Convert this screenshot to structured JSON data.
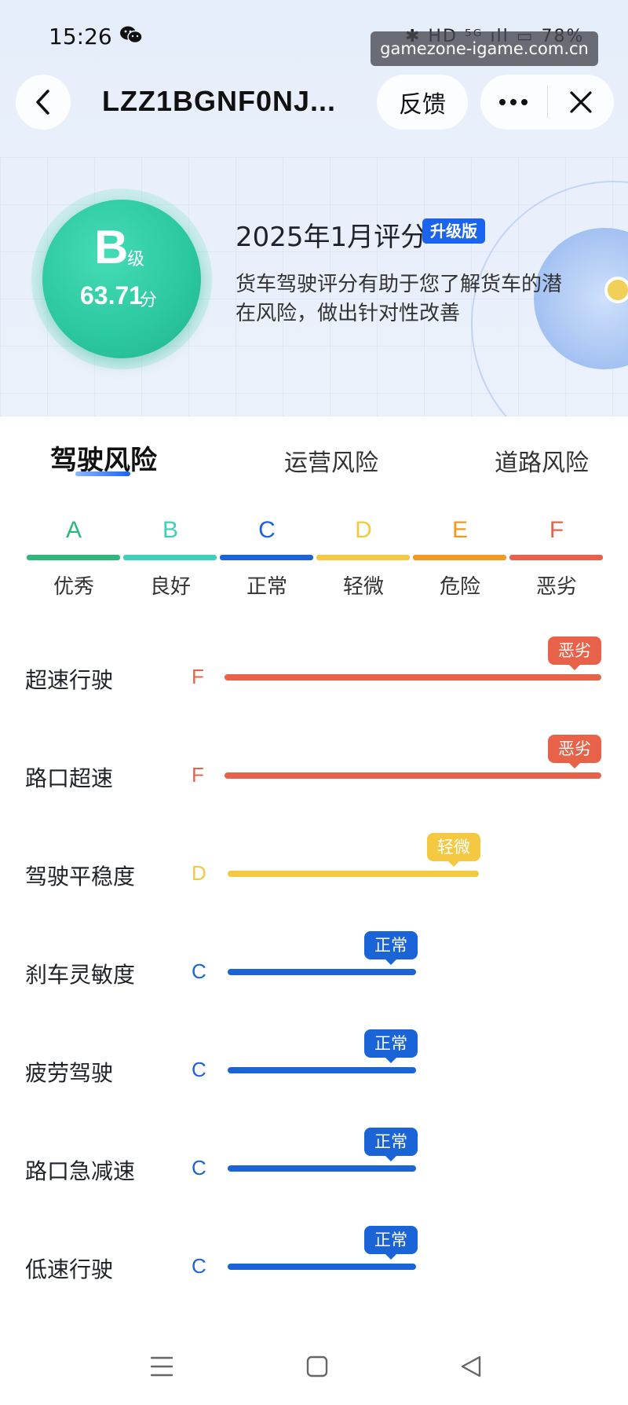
{
  "status_bar": {
    "time": "15:26",
    "right_text": "✱ HD ⁵ᴳ ıll ▭ 78%",
    "battery": "78%"
  },
  "watermark": "gamezone-igame.com.cn",
  "nav": {
    "title": "LZZ1BGNF0NJ...",
    "feedback_label": "反馈"
  },
  "hero": {
    "grade_letter": "B",
    "grade_suffix": "级",
    "score": "63.71",
    "score_unit": "分",
    "eval_title": "2025年1月评分",
    "badge": "升级版",
    "description": "货车驾驶评分有助于您了解货车的潜在风险，做出针对性改善"
  },
  "tabs": [
    {
      "label": "驾驶风险",
      "active": true
    },
    {
      "label": "运营风险",
      "active": false
    },
    {
      "label": "道路风险",
      "active": false
    }
  ],
  "legend": [
    {
      "letter": "A",
      "label": "优秀",
      "color": "#2eb87d"
    },
    {
      "letter": "B",
      "label": "良好",
      "color": "#3fd0bd"
    },
    {
      "letter": "C",
      "label": "正常",
      "color": "#1b64d8"
    },
    {
      "letter": "D",
      "label": "轻微",
      "color": "#f5c842"
    },
    {
      "letter": "E",
      "label": "危险",
      "color": "#f29a1f"
    },
    {
      "letter": "F",
      "label": "恶劣",
      "color": "#e8624a"
    }
  ],
  "rows": [
    {
      "label": "超速行驶",
      "grade": "F",
      "badge": "恶劣",
      "color": "#e8624a",
      "level": 1.0
    },
    {
      "label": "路口超速",
      "grade": "F",
      "badge": "恶劣",
      "color": "#e8624a",
      "level": 1.0
    },
    {
      "label": "驾驶平稳度",
      "grade": "D",
      "badge": "轻微",
      "color": "#f5c842",
      "level": 0.66
    },
    {
      "label": "刹车灵敏度",
      "grade": "C",
      "badge": "正常",
      "color": "#1b64d8",
      "level": 0.5
    },
    {
      "label": "疲劳驾驶",
      "grade": "C",
      "badge": "正常",
      "color": "#1b64d8",
      "level": 0.5
    },
    {
      "label": "路口急减速",
      "grade": "C",
      "badge": "正常",
      "color": "#1b64d8",
      "level": 0.5
    },
    {
      "label": "低速行驶",
      "grade": "C",
      "badge": "正常",
      "color": "#1b64d8",
      "level": 0.5
    }
  ],
  "icons": {
    "back": "chevron-left-icon",
    "more": "more-dots-icon",
    "close": "close-icon",
    "wechat": "wechat-icon",
    "menu": "menu-icon",
    "home": "home-square-icon",
    "back_triangle": "back-triangle-icon"
  }
}
